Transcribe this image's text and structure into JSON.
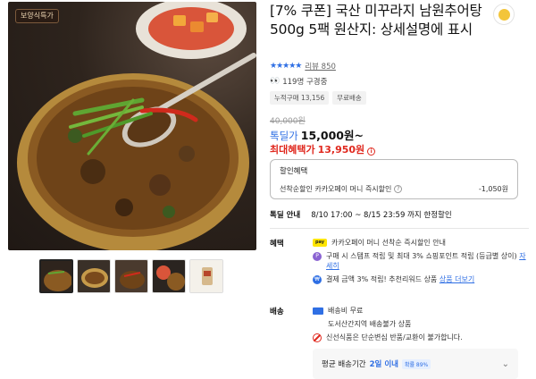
{
  "gallery": {
    "brand_badge": "보양식특가",
    "thumbnail_count": 5
  },
  "product": {
    "title": "[7% 쿠폰] 국산 미꾸라지 남원추어탕 500g 5팩 원산지: 상세설명에 표시",
    "rating_stars": "★★★★★",
    "review_text": "리뷰 850",
    "buyers_text": "119명 구경중",
    "chips": [
      "누적구매 13,156",
      "무료배송"
    ],
    "original_price": "40,000원",
    "sale_label": "톡딜가",
    "sale_price": "15,000원~",
    "max_benefit_label": "최대혜택가",
    "max_benefit_price": "13,950원",
    "info_icon_glyph": "i"
  },
  "discount": {
    "title": "할인혜택",
    "line_label": "선착순할인 카카오페이 머니 즉시할인",
    "line_amount": "-1,050원"
  },
  "special": {
    "label": "톡딜 안내",
    "period": "8/10 17:00 ~ 8/15 23:59 까지 한정할인"
  },
  "benefits": {
    "label": "혜택",
    "pay_logo": "pay",
    "p_glyph": "P",
    "pay_glyph": "₩",
    "item1": "카카오페이 머니 선착순 즉시할인 안내",
    "item2_text": "구매 시 스탬프 적립 및 최대 3% 쇼핑포인트 적립 (등급별 상이)",
    "item2_link": "자세히",
    "item3_text": "결제 금액 3% 적립! 추천리워드 상품",
    "item3_link": "상품 더보기"
  },
  "shipping": {
    "label": "배송",
    "fee": "배송비 무료",
    "fee_icon": "truck-icon",
    "region": "도서산간지역 배송불가 상품",
    "notice": "신선식품은 단순변심 반품/교환이 불가합니다.",
    "delivery_label": "평균 배송기간",
    "delivery_days": "2일 이내",
    "delivery_badge": "확률 89%",
    "chevron": "⌄"
  }
}
